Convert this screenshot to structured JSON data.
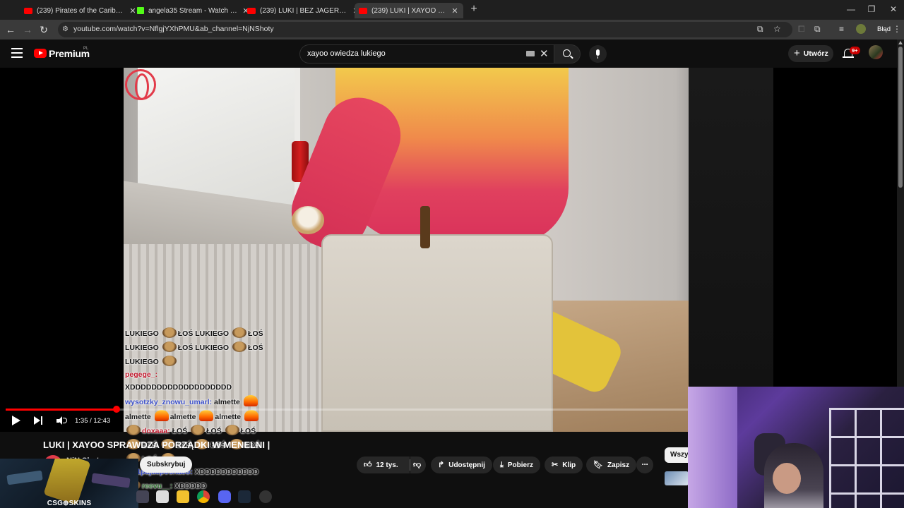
{
  "browser": {
    "tabs": [
      {
        "title": "(239) Pirates of the Caribbean",
        "favicon": "youtube-icon",
        "active": false
      },
      {
        "title": "angela35 Stream - Watch Live o",
        "favicon": "kick-icon",
        "active": false
      },
      {
        "title": "(239) LUKI | BEZ JAGERKA TO N",
        "favicon": "youtube-icon",
        "active": false
      },
      {
        "title": "(239) LUKI | XAYOO SPRAWDZA",
        "favicon": "youtube-icon",
        "active": true
      }
    ],
    "new_tab": "+",
    "window_controls": {
      "minimize": "—",
      "maximize": "❐",
      "close": "✕"
    },
    "url": "youtube.com/watch?v=NflgjYXhPMU&ab_channel=NjNShoty",
    "profile_status": "Błąd"
  },
  "youtube": {
    "brand": "Premium",
    "region": "PL",
    "search": {
      "query": "xayoo owiedza lukiego"
    },
    "create_label": "Utwórz",
    "notifications_badge": "9+"
  },
  "player": {
    "current_time": "1:35",
    "duration": "12:43",
    "time_display": "1:35 / 12:43",
    "progress": 0.163
  },
  "chat": [
    {
      "segments": [
        {
          "type": "text",
          "text": "LUKIEGO"
        },
        {
          "type": "emote"
        },
        {
          "type": "text",
          "text": "ŁOŚ LUKIEGO"
        },
        {
          "type": "emote"
        },
        {
          "type": "text",
          "text": "ŁOŚ"
        }
      ]
    },
    {
      "segments": [
        {
          "type": "text",
          "text": "LUKIEGO"
        },
        {
          "type": "emote"
        },
        {
          "type": "text",
          "text": "ŁOŚ LUKIEGO"
        },
        {
          "type": "emote"
        },
        {
          "type": "text",
          "text": "ŁOŚ"
        }
      ]
    },
    {
      "segments": [
        {
          "type": "text",
          "text": "LUKIEGO"
        },
        {
          "type": "emote"
        }
      ]
    },
    {
      "segments": [
        {
          "type": "user",
          "color": "red",
          "text": "pegege_:"
        }
      ]
    },
    {
      "segments": [
        {
          "type": "text",
          "text": "XDDDDDDDDDDDDDDDDDDD"
        }
      ]
    },
    {
      "segments": [
        {
          "type": "user",
          "color": "blue",
          "text": "wysotzky_znowu_umarl:"
        },
        {
          "type": "text",
          "text": "almette"
        },
        {
          "type": "fire"
        }
      ]
    },
    {
      "segments": [
        {
          "type": "text",
          "text": "almette"
        },
        {
          "type": "fire"
        },
        {
          "type": "text",
          "text": "almette"
        },
        {
          "type": "fire"
        },
        {
          "type": "text",
          "text": "almette"
        },
        {
          "type": "fire"
        }
      ]
    },
    {
      "segments": [
        {
          "type": "emote"
        },
        {
          "type": "user",
          "color": "red",
          "text": "doxaaa:"
        },
        {
          "type": "text",
          "text": "ŁOŚ"
        },
        {
          "type": "emote"
        },
        {
          "type": "text",
          "text": "ŁOŚ"
        },
        {
          "type": "emote"
        },
        {
          "type": "text",
          "text": "ŁOŚ"
        }
      ]
    },
    {
      "segments": [
        {
          "type": "emote"
        },
        {
          "type": "text",
          "text": "ŁOŚ"
        },
        {
          "type": "emote"
        },
        {
          "type": "text",
          "text": "ŁOŚ"
        },
        {
          "type": "emote"
        },
        {
          "type": "text",
          "text": "ŁOŚ"
        },
        {
          "type": "emote"
        },
        {
          "type": "text",
          "text": "ŁOŚ"
        }
      ]
    },
    {
      "segments": [
        {
          "type": "emote"
        },
        {
          "type": "text",
          "text": "ŁOŚ"
        },
        {
          "type": "emote"
        }
      ]
    },
    {
      "segments": [
        {
          "type": "user",
          "color": "blue",
          "text": "top1pajacposhaco:"
        },
        {
          "type": "text",
          "text": "XDDDDDDDDDDD"
        }
      ]
    },
    {
      "segments": [
        {
          "type": "emote"
        },
        {
          "type": "user",
          "color": "green",
          "text": "reevu__:"
        },
        {
          "type": "text",
          "text": "XDDDDD"
        }
      ]
    }
  ],
  "video": {
    "title": "LUKI | XAYOO SPRAWDZA PORZĄDKI W MENELNI |",
    "channel": "NjN Shoty",
    "subscribe_label": "Subskrybuj",
    "likes": "12 tys.",
    "share_label": "Udostępnij",
    "download_label": "Pobierz",
    "clip_label": "Klip",
    "save_label": "Zapisz",
    "more_label": "···"
  },
  "sidebar": {
    "filter_chip": "Wszy"
  },
  "overlay": {
    "csgo_label": "CSG⊕SKINS"
  },
  "colors": {
    "youtube_red": "#ff0000",
    "kick_green": "#53fc18",
    "background": "#0f0f0f"
  }
}
